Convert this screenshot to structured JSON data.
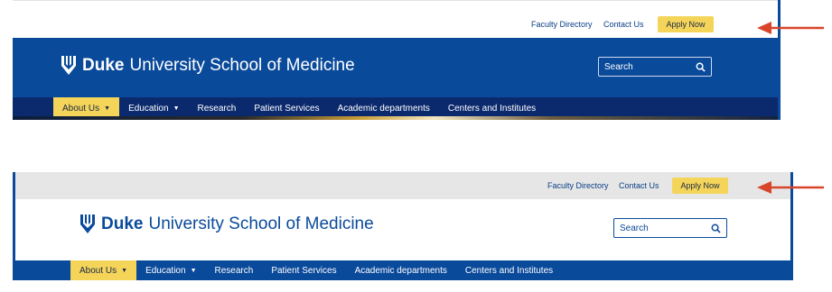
{
  "utility": {
    "faculty_directory": "Faculty Directory",
    "contact_us": "Contact Us",
    "apply_now": "Apply Now"
  },
  "logo": {
    "duke": "Duke",
    "rest": "University School of Medicine"
  },
  "search": {
    "placeholder": "Search"
  },
  "nav": [
    {
      "label": "About Us",
      "dropdown": true,
      "active": true
    },
    {
      "label": "Education",
      "dropdown": true,
      "active": false
    },
    {
      "label": "Research",
      "dropdown": false,
      "active": false
    },
    {
      "label": "Patient Services",
      "dropdown": false,
      "active": false
    },
    {
      "label": "Academic departments",
      "dropdown": false,
      "active": false
    },
    {
      "label": "Centers and Institutes",
      "dropdown": false,
      "active": false
    }
  ],
  "caret": "▼",
  "colors": {
    "duke_blue": "#0a4a9b",
    "nav_dark": "#0b2a6e",
    "gold": "#f5d45a",
    "arrow_red": "#d8452b",
    "utility_gray": "#e6e6e6"
  },
  "icons": [
    "duke-shield-logo-icon",
    "search-icon",
    "chevron-down-icon",
    "red-arrow-icon"
  ]
}
